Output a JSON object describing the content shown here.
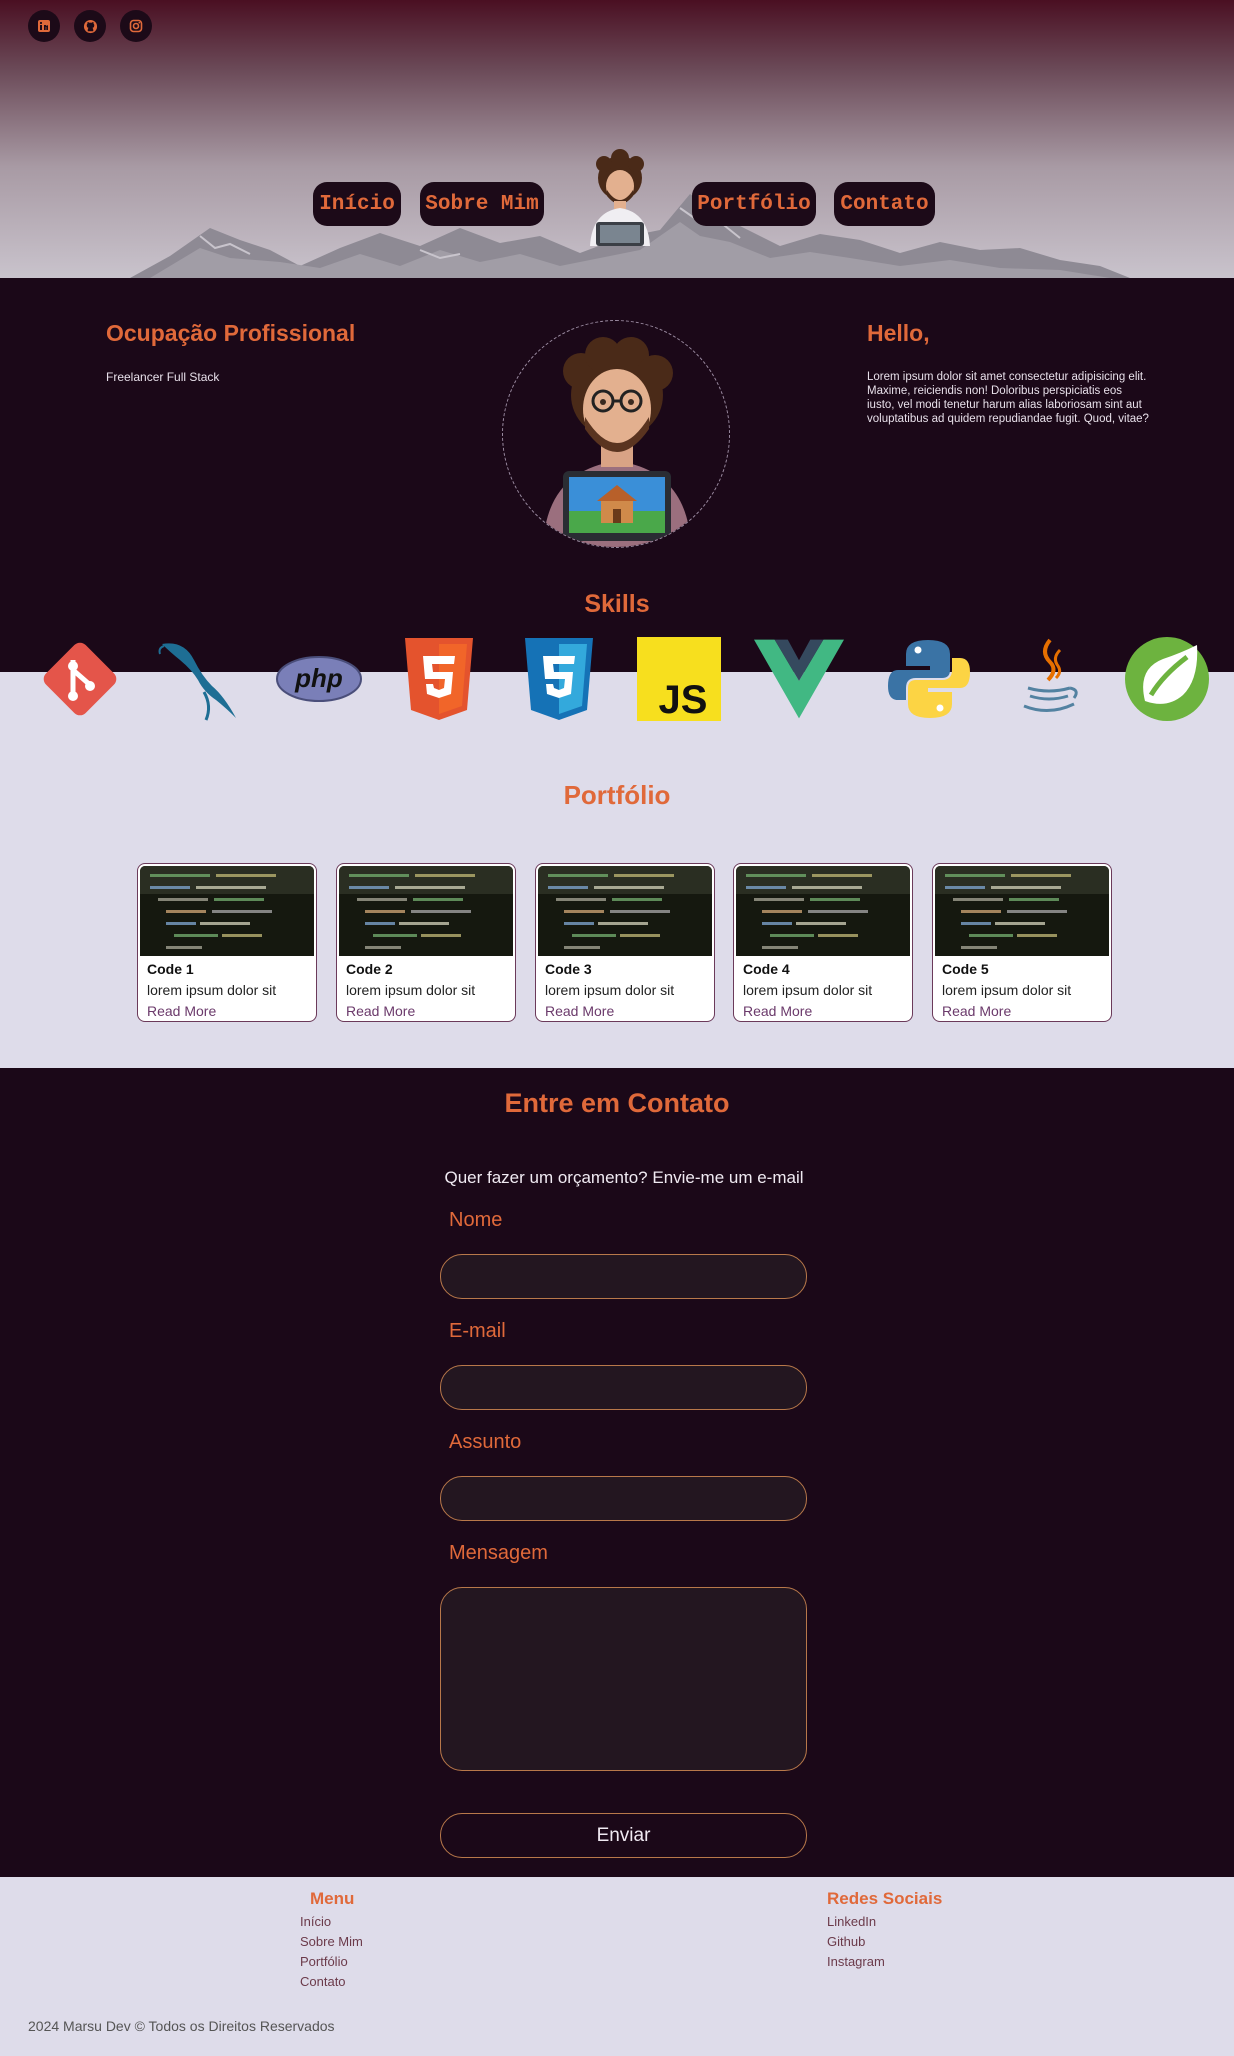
{
  "social": {
    "items": [
      {
        "name": "linkedin-icon"
      },
      {
        "name": "github-icon"
      },
      {
        "name": "instagram-icon"
      }
    ]
  },
  "nav": {
    "inicio": "Início",
    "sobre": "Sobre Mim",
    "portfolio": "Portfólio",
    "contato": "Contato"
  },
  "about": {
    "occupation_title": "Ocupação Profissional",
    "occupation_text": "Freelancer Full Stack",
    "hello_title": "Hello,",
    "hello_text": "Lorem ipsum dolor sit amet consectetur adipisicing elit. Maxime, reiciendis non! Doloribus perspiciatis eos iusto, vel modi tenetur harum alias laboriosam sint aut voluptatibus ad quidem repudiandae fugit. Quod, vitae?"
  },
  "skills": {
    "title": "Skills",
    "items": [
      "git",
      "mysql",
      "php",
      "html5",
      "css3",
      "javascript",
      "vue",
      "python",
      "java",
      "spring"
    ],
    "js_text": "JS",
    "php_text": "php"
  },
  "portfolio": {
    "title": "Portfólio",
    "cards": [
      {
        "title": "Code 1",
        "desc": "lorem ipsum dolor sit",
        "link": "Read More"
      },
      {
        "title": "Code 2",
        "desc": "lorem ipsum dolor sit",
        "link": "Read More"
      },
      {
        "title": "Code 3",
        "desc": "lorem ipsum dolor sit",
        "link": "Read More"
      },
      {
        "title": "Code 4",
        "desc": "lorem ipsum dolor sit",
        "link": "Read More"
      },
      {
        "title": "Code 5",
        "desc": "lorem ipsum dolor sit",
        "link": "Read More"
      }
    ]
  },
  "contact": {
    "title": "Entre em Contato",
    "subtitle": "Quer fazer um orçamento? Envie-me um e-mail",
    "name_label": "Nome",
    "email_label": "E-mail",
    "subject_label": "Assunto",
    "message_label": "Mensagem",
    "submit_label": "Enviar"
  },
  "footer": {
    "menu_title": "Menu",
    "menu_items": [
      "Início",
      "Sobre Mim",
      "Portfólio",
      "Contato"
    ],
    "social_title": "Redes Sociais",
    "social_items": [
      "LinkedIn",
      "Github",
      "Instagram"
    ],
    "copyright": "2024 Marsu Dev © Todos os Direitos Reservados"
  },
  "colors": {
    "accent": "#e0693a",
    "dark_bg": "#1b0818",
    "light_bg": "#dedcea"
  }
}
